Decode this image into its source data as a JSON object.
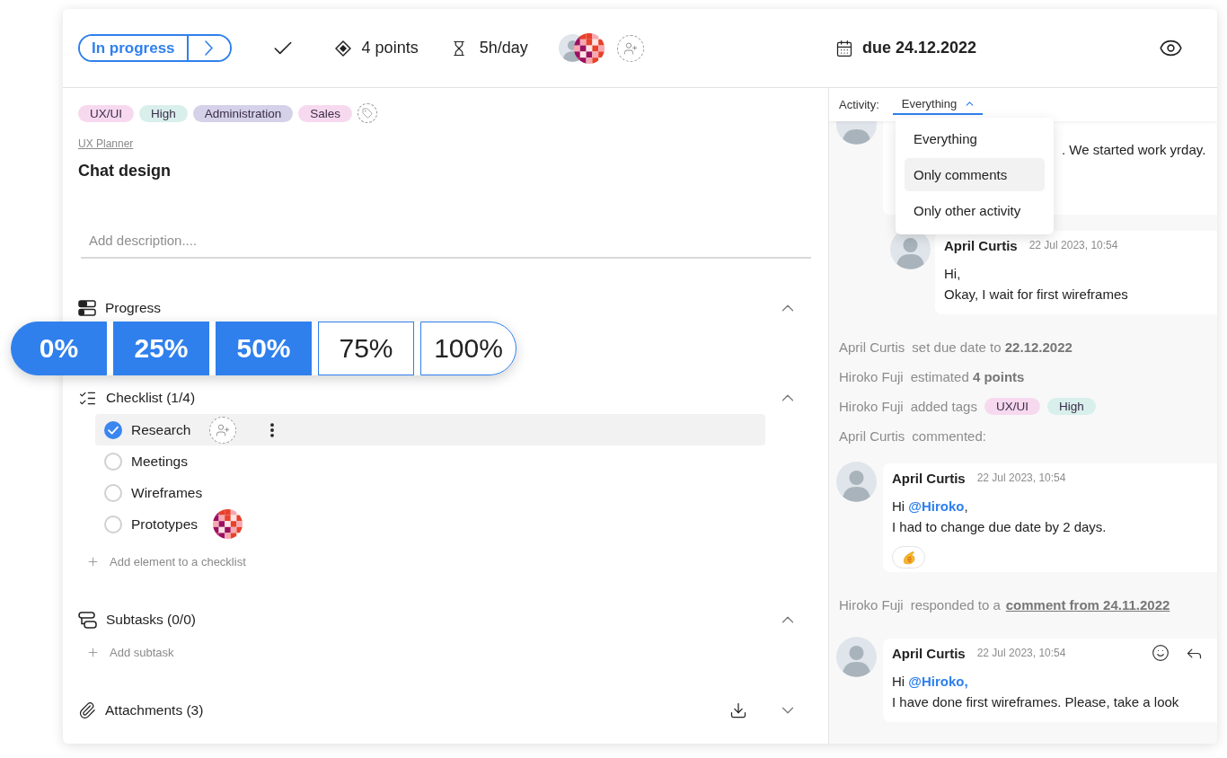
{
  "header": {
    "status": {
      "label": "In progress"
    },
    "points": "4 points",
    "time": "5h/day",
    "assignees": [
      {
        "kind": "photo"
      },
      {
        "kind": "mosaic"
      }
    ],
    "due": "due 24.12.2022"
  },
  "task": {
    "tags": [
      {
        "label": "UX/UI",
        "color": "#f7d9ef"
      },
      {
        "label": "High",
        "color": "#d9efec"
      },
      {
        "label": "Administration",
        "color": "#d5d1e9"
      },
      {
        "label": "Sales",
        "color": "#f7d9ef"
      }
    ],
    "project": "UX Planner",
    "title": "Chat design",
    "description": {
      "placeholder": "Add description...."
    }
  },
  "progress": {
    "title": "Progress",
    "expanded": true,
    "segments": [
      {
        "label": "0%",
        "filled": true
      },
      {
        "label": "25%",
        "filled": true
      },
      {
        "label": "50%",
        "filled": true
      },
      {
        "label": "75%",
        "filled": false
      },
      {
        "label": "100%",
        "filled": false
      }
    ]
  },
  "checklist": {
    "title": "Checklist (1/4)",
    "expanded": true,
    "items": [
      {
        "label": "Research",
        "checked": true,
        "hovered": true
      },
      {
        "label": "Meetings",
        "checked": false,
        "hovered": false
      },
      {
        "label": "Wireframes",
        "checked": false,
        "hovered": false
      },
      {
        "label": "Prototypes",
        "checked": false,
        "hovered": false,
        "assignee": {
          "kind": "mosaic"
        }
      }
    ],
    "add_label": "Add element to a checklist"
  },
  "subtasks": {
    "title": "Subtasks (0/0)",
    "expanded": true,
    "add_label": "Add subtask"
  },
  "attachments": {
    "title": "Attachments (3)",
    "expanded": false
  },
  "activity": {
    "label": "Activity:",
    "filter": {
      "value": "Everything",
      "expanded": true,
      "options": [
        {
          "label": "Everything",
          "highlighted": false
        },
        {
          "label": "Only comments",
          "highlighted": true
        },
        {
          "label": "Only other activity",
          "highlighted": false
        }
      ]
    },
    "feed": [
      {
        "kind": "clipped_comment",
        "text": ". We started work yrday.",
        "replies": [
          {
            "author": "April Curtis",
            "time": "22 Jul 2023, 10:54",
            "hovered": false,
            "lines": [
              [
                {
                  "kind": "text",
                  "text": "Hi,"
                }
              ],
              [
                {
                  "kind": "text",
                  "text": "Okay, I wait for first wireframes"
                }
              ]
            ]
          }
        ]
      },
      {
        "kind": "event",
        "actor": "April Curtis",
        "text": "set due date to **22.12.2022**"
      },
      {
        "kind": "event",
        "actor": "Hiroko Fuji",
        "text": "estimated **4 points**"
      },
      {
        "kind": "event",
        "actor": "Hiroko Fuji",
        "text": "added tags",
        "tags": [
          {
            "label": "UX/UI",
            "color": "#f7d9ef"
          },
          {
            "label": "High",
            "color": "#d9efec"
          }
        ]
      },
      {
        "kind": "event",
        "actor": "April Curtis",
        "text": "commented:"
      },
      {
        "kind": "comment",
        "author": "April Curtis",
        "time": "22 Jul 2023, 10:54",
        "hovered": false,
        "lines": [
          [
            {
              "kind": "text",
              "text": "Hi "
            },
            {
              "kind": "mention",
              "text": "@Hiroko"
            },
            {
              "kind": "text",
              "text": ","
            }
          ],
          [
            {
              "kind": "text",
              "text": "I had to change due date by 2 days."
            }
          ]
        ],
        "reactions": [
          {
            "kind": "emoji"
          }
        ]
      },
      {
        "kind": "event",
        "actor": "Hiroko Fuji",
        "text": "responded to a",
        "link": "comment from 24.11.2022"
      },
      {
        "kind": "comment",
        "author": "April Curtis",
        "time": "22 Jul 2023, 10:54",
        "hovered": true,
        "lines": [
          [
            {
              "kind": "text",
              "text": "Hi "
            },
            {
              "kind": "mention",
              "text": "@Hiroko,"
            }
          ],
          [
            {
              "kind": "text",
              "text": "I have done first wireframes. Please, take a look"
            }
          ]
        ]
      }
    ]
  }
}
